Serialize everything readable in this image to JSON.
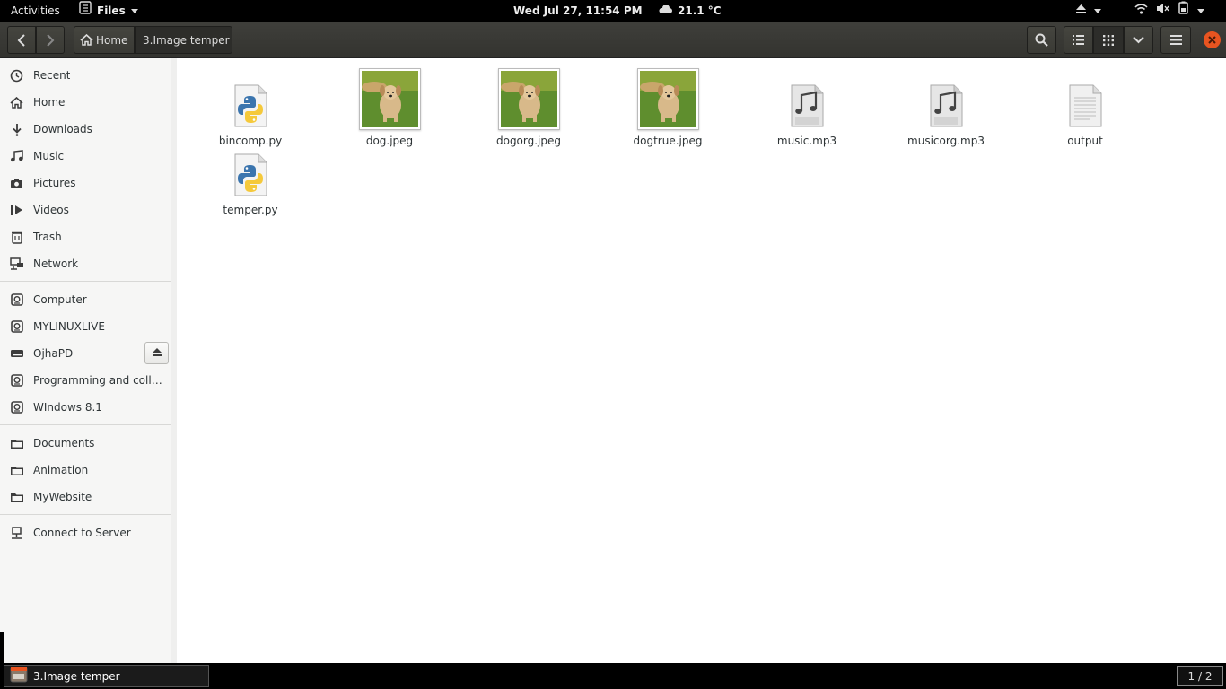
{
  "topbar": {
    "activities": "Activities",
    "app_menu": "Files",
    "clock": "Wed Jul 27, 11:54 PM",
    "weather": "21.1 °C"
  },
  "header": {
    "breadcrumbs": [
      "Home",
      "3.Image temper"
    ]
  },
  "sidebar": {
    "places": [
      "Recent",
      "Home",
      "Downloads",
      "Music",
      "Pictures",
      "Videos",
      "Trash",
      "Network"
    ],
    "devices": [
      "Computer",
      "MYLINUXLIVE",
      "OjhaPD",
      "Programming and colleg…",
      "WIndows 8.1"
    ],
    "bookmarks": [
      "Documents",
      "Animation",
      "MyWebsite"
    ],
    "connect": "Connect to Server"
  },
  "files": [
    {
      "name": "bincomp.py",
      "kind": "python"
    },
    {
      "name": "dog.jpeg",
      "kind": "image"
    },
    {
      "name": "dogorg.jpeg",
      "kind": "image"
    },
    {
      "name": "dogtrue.jpeg",
      "kind": "image"
    },
    {
      "name": "music.mp3",
      "kind": "audio"
    },
    {
      "name": "musicorg.mp3",
      "kind": "audio"
    },
    {
      "name": "output",
      "kind": "text"
    },
    {
      "name": "temper.py",
      "kind": "python"
    }
  ],
  "taskbar": {
    "window_title": "3.Image temper",
    "workspace": "1 / 2"
  },
  "colors": {
    "close": "#e95420",
    "header_bg": "#3a3a36"
  }
}
